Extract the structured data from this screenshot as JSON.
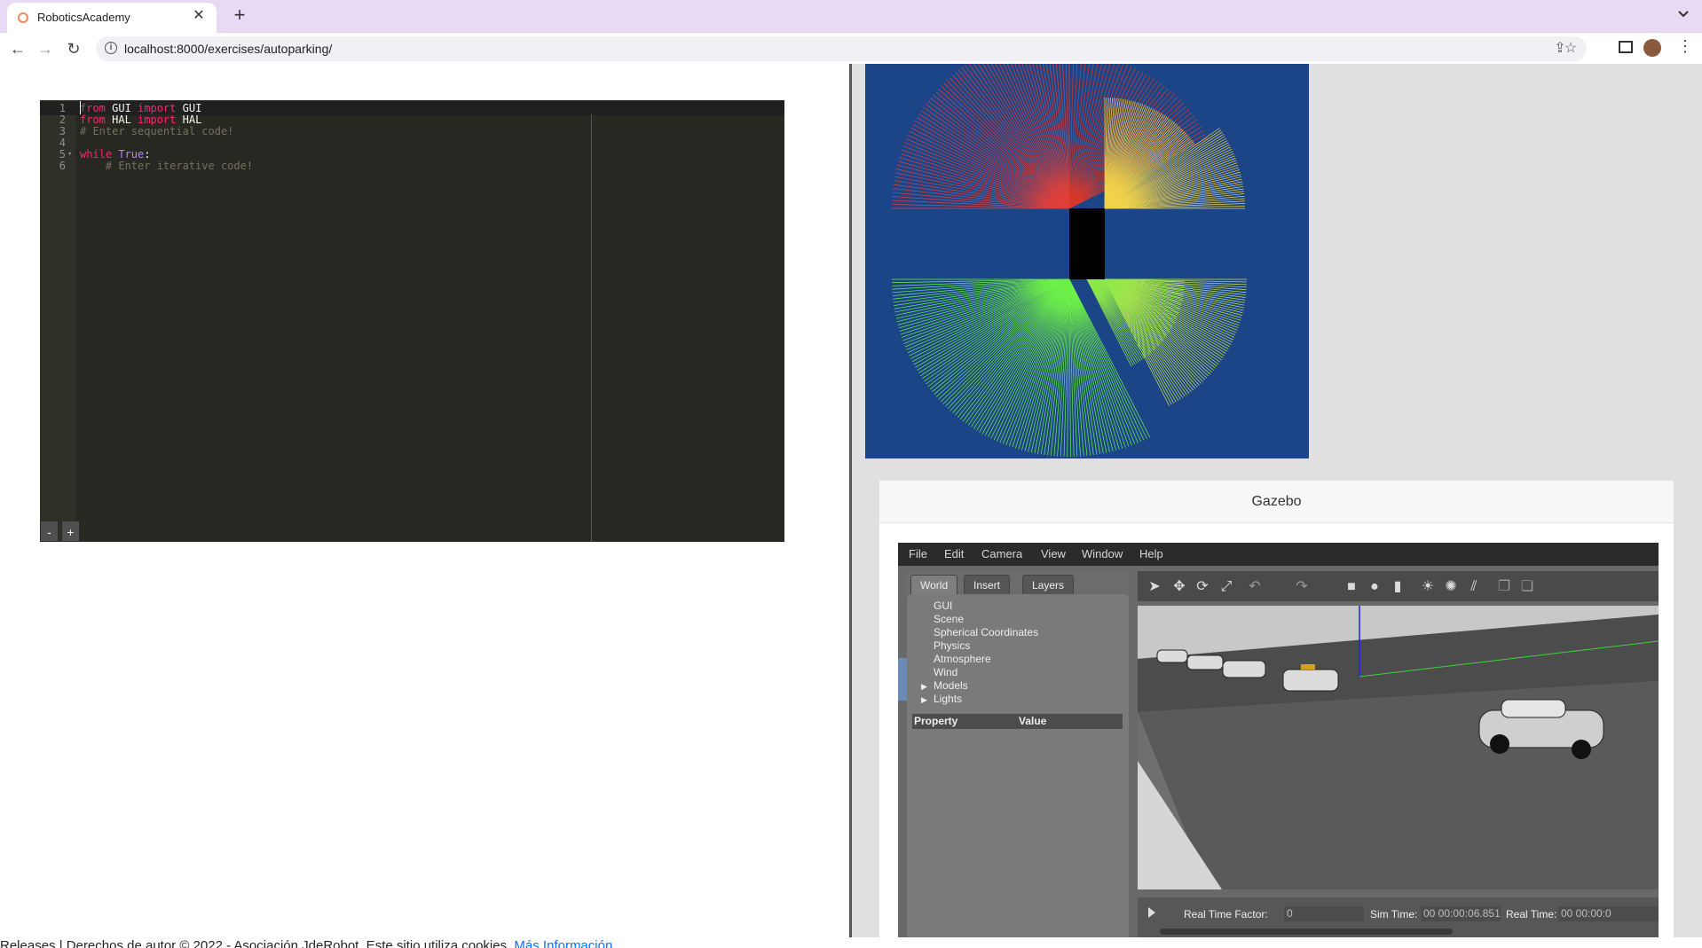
{
  "browser": {
    "tab_title": "RoboticsAcademy",
    "url": "localhost:8000/exercises/autoparking/"
  },
  "editor": {
    "lines": [
      {
        "n": "1",
        "tokens": [
          [
            "kw",
            "from"
          ],
          [
            "txt",
            " GUI "
          ],
          [
            "kw",
            "import"
          ],
          [
            "txt",
            " GUI"
          ]
        ]
      },
      {
        "n": "2",
        "tokens": [
          [
            "kw",
            "from"
          ],
          [
            "txt",
            " HAL "
          ],
          [
            "kw",
            "import"
          ],
          [
            "txt",
            " HAL"
          ]
        ]
      },
      {
        "n": "3",
        "tokens": [
          [
            "cm",
            "# Enter sequential code!"
          ]
        ]
      },
      {
        "n": "4",
        "tokens": []
      },
      {
        "n": "5",
        "tokens": [
          [
            "kw",
            "while"
          ],
          [
            "txt",
            " "
          ],
          [
            "const",
            "True"
          ],
          [
            "txt",
            ":"
          ]
        ]
      },
      {
        "n": "6",
        "tokens": [
          [
            "txt",
            "    "
          ],
          [
            "cm",
            "# Enter iterative code!"
          ]
        ]
      }
    ],
    "font_minus": "-",
    "font_plus": "+"
  },
  "gazebo": {
    "title": "Gazebo",
    "menu": [
      "File",
      "Edit",
      "Camera",
      "View",
      "Window",
      "Help"
    ],
    "tabs": [
      "World",
      "Insert",
      "Layers"
    ],
    "tree": [
      {
        "label": "GUI",
        "expandable": false
      },
      {
        "label": "Scene",
        "expandable": false
      },
      {
        "label": "Spherical Coordinates",
        "expandable": false
      },
      {
        "label": "Physics",
        "expandable": false
      },
      {
        "label": "Atmosphere",
        "expandable": false
      },
      {
        "label": "Wind",
        "expandable": false
      },
      {
        "label": "Models",
        "expandable": true
      },
      {
        "label": "Lights",
        "expandable": true
      }
    ],
    "property_header": "Property",
    "value_header": "Value",
    "status": {
      "rtf_label": "Real Time Factor:",
      "rtf_value": "0",
      "sim_label": "Sim Time:",
      "sim_value": "00 00:00:06.851",
      "real_label": "Real Time:",
      "real_value": "00 00:00:0"
    }
  },
  "footer": {
    "text": "Releases | Derechos de autor © 2022 - Asociación JdeRobot. Este sitio utiliza cookies. ",
    "link": "Más Información"
  }
}
